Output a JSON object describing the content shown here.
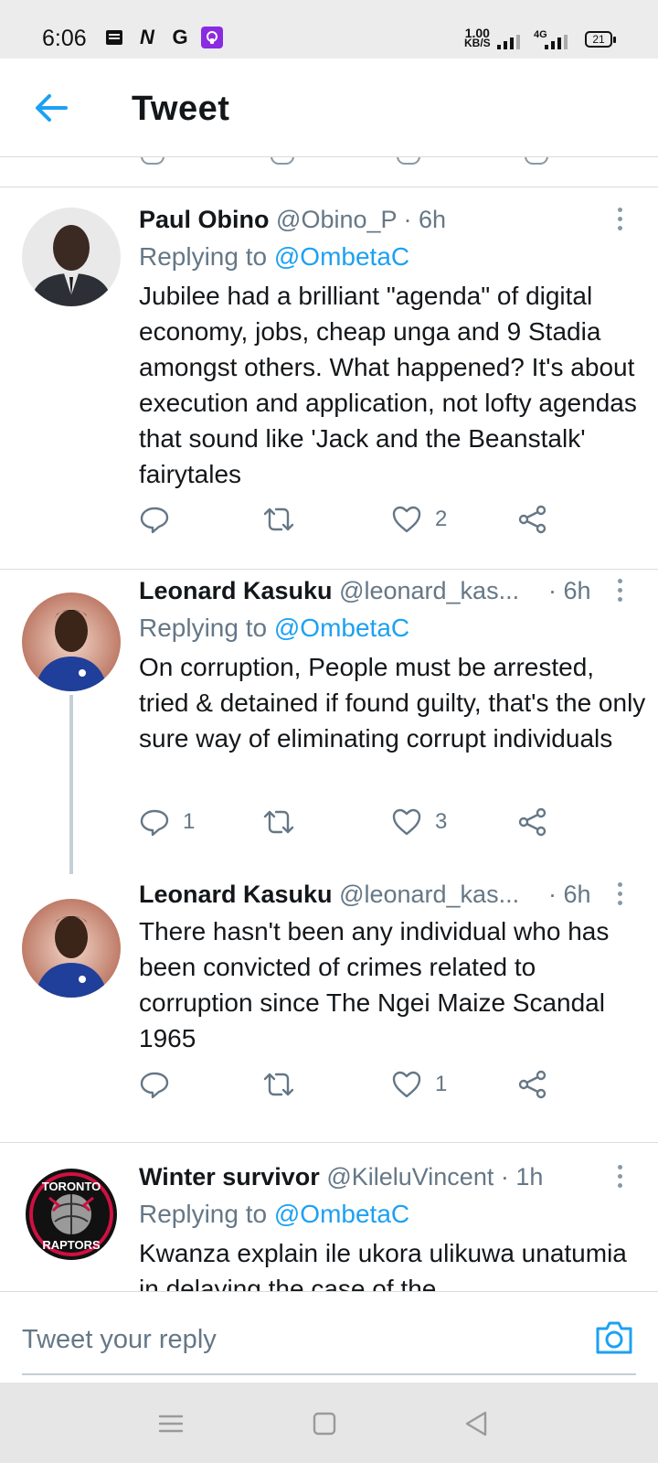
{
  "status_bar": {
    "time": "6:06",
    "left_icons": [
      "document-icon",
      "n-icon",
      "g-icon",
      "podcast-icon"
    ],
    "speed_value": "1.00",
    "speed_unit": "KB/S",
    "network": "4G",
    "battery": "21"
  },
  "header": {
    "title": "Tweet"
  },
  "tweets": [
    {
      "name": "Paul Obino",
      "handle": "@Obino_P · 6h",
      "replying_prefix": "Replying to ",
      "replying_to": "@OmbetaC",
      "body": "Jubilee had a brilliant \"agenda\" of digital economy,  jobs, cheap unga and 9 Stadia amongst others. What happened? It's about execution and application,  not lofty agendas that sound like 'Jack and the Beanstalk' fairytales",
      "reply_count": "",
      "retweet_count": "",
      "like_count": "2"
    },
    {
      "name": "Leonard Kasuku",
      "handle": "@leonard_kas...",
      "time": "· 6h",
      "replying_prefix": "Replying to ",
      "replying_to": "@OmbetaC",
      "body": "On corruption, People must be arrested, tried & detained if found guilty, that's the only sure way of eliminating corrupt individuals",
      "reply_count": "1",
      "retweet_count": "",
      "like_count": "3"
    },
    {
      "name": "Leonard Kasuku",
      "handle": "@leonard_kas...",
      "time": "· 6h",
      "body": "There hasn't been any individual who has been convicted of crimes related to corruption since The Ngei Maize Scandal 1965",
      "reply_count": "",
      "retweet_count": "",
      "like_count": "1"
    },
    {
      "name": "Winter survivor",
      "handle": "@KileluVincent · 1h",
      "replying_prefix": "Replying to ",
      "replying_to": "@OmbetaC",
      "body": "Kwanza explain ile ukora ulikuwa unatumia in delaying the case of the",
      "avatar_text_top": "TORONTO",
      "avatar_text_bottom": "RAPTORS"
    }
  ],
  "reply_bar": {
    "placeholder": "Tweet your reply"
  },
  "colors": {
    "accent": "#1da1f2",
    "secondary_text": "#657786",
    "primary_text": "#14171a"
  }
}
